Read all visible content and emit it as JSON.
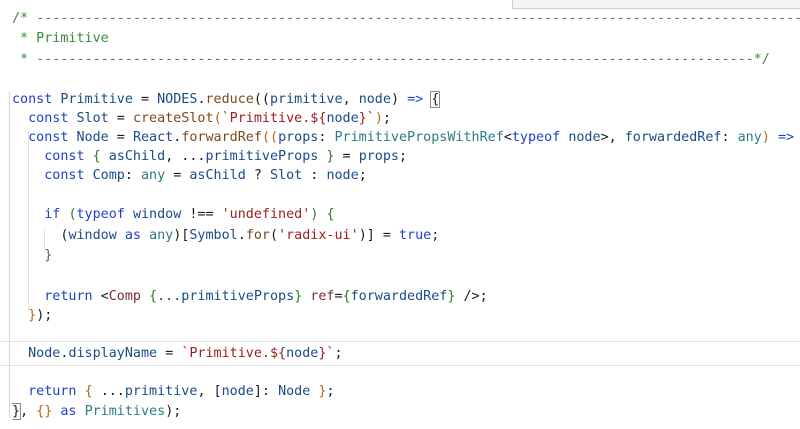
{
  "editor": {
    "lines": [
      {
        "tokens": [
          {
            "t": "/* ",
            "c": "cm"
          },
          {
            "t": "--------------------------------------------------------------------------------------------------",
            "c": "cm"
          }
        ]
      },
      {
        "tokens": [
          {
            "t": " * Primitive",
            "c": "cm"
          }
        ]
      },
      {
        "tokens": [
          {
            "t": " * -----------------------------------------------------------------------------------------*/",
            "c": "cm"
          }
        ]
      },
      {
        "tokens": []
      },
      {
        "tokens": [
          {
            "t": "const ",
            "c": "kw"
          },
          {
            "t": "Primitive",
            "c": "var"
          },
          {
            "t": " = ",
            "c": "p1"
          },
          {
            "t": "NODES",
            "c": "var"
          },
          {
            "t": ".",
            "c": "p1"
          },
          {
            "t": "reduce",
            "c": "fn"
          },
          {
            "t": "((",
            "c": "p1"
          },
          {
            "t": "primitive",
            "c": "var"
          },
          {
            "t": ", ",
            "c": "p1"
          },
          {
            "t": "node",
            "c": "var"
          },
          {
            "t": ") ",
            "c": "p1"
          },
          {
            "t": "=>",
            "c": "kw"
          },
          {
            "t": " ",
            "c": "p1"
          },
          {
            "t": "{",
            "c": "p1",
            "match": true
          }
        ]
      },
      {
        "tokens": [
          {
            "t": "  const ",
            "c": "kw"
          },
          {
            "t": "Slot",
            "c": "var"
          },
          {
            "t": " = ",
            "c": "p1"
          },
          {
            "t": "createSlot",
            "c": "fn"
          },
          {
            "t": "(",
            "c": "p2"
          },
          {
            "t": "`Primitive.${",
            "c": "str"
          },
          {
            "t": "node",
            "c": "var"
          },
          {
            "t": "}`",
            "c": "str"
          },
          {
            "t": ")",
            "c": "p2"
          },
          {
            "t": ";",
            "c": "p1"
          }
        ]
      },
      {
        "tokens": [
          {
            "t": "  const ",
            "c": "kw"
          },
          {
            "t": "Node",
            "c": "var"
          },
          {
            "t": " = ",
            "c": "p1"
          },
          {
            "t": "React",
            "c": "var"
          },
          {
            "t": ".",
            "c": "p1"
          },
          {
            "t": "forwardRef",
            "c": "fn"
          },
          {
            "t": "((",
            "c": "p2"
          },
          {
            "t": "props",
            "c": "var"
          },
          {
            "t": ": ",
            "c": "p1"
          },
          {
            "t": "PrimitivePropsWithRef",
            "c": "ty"
          },
          {
            "t": "<",
            "c": "p1"
          },
          {
            "t": "typeof ",
            "c": "kw"
          },
          {
            "t": "node",
            "c": "var"
          },
          {
            "t": ">, ",
            "c": "p1"
          },
          {
            "t": "forwardedRef",
            "c": "var"
          },
          {
            "t": ": ",
            "c": "p1"
          },
          {
            "t": "any",
            "c": "ty"
          },
          {
            "t": ") ",
            "c": "p2"
          },
          {
            "t": "=>",
            "c": "kw"
          },
          {
            "t": " {",
            "c": "p2"
          }
        ]
      },
      {
        "tokens": [
          {
            "t": "    const ",
            "c": "kw"
          },
          {
            "t": "{ ",
            "c": "p3"
          },
          {
            "t": "asChild",
            "c": "var"
          },
          {
            "t": ", ...",
            "c": "p1"
          },
          {
            "t": "primitiveProps",
            "c": "var"
          },
          {
            "t": " }",
            "c": "p3"
          },
          {
            "t": " = ",
            "c": "p1"
          },
          {
            "t": "props",
            "c": "var"
          },
          {
            "t": ";",
            "c": "p1"
          }
        ]
      },
      {
        "tokens": [
          {
            "t": "    const ",
            "c": "kw"
          },
          {
            "t": "Comp",
            "c": "var"
          },
          {
            "t": ": ",
            "c": "p1"
          },
          {
            "t": "any",
            "c": "ty"
          },
          {
            "t": " = ",
            "c": "p1"
          },
          {
            "t": "asChild",
            "c": "var"
          },
          {
            "t": " ? ",
            "c": "p1"
          },
          {
            "t": "Slot",
            "c": "var"
          },
          {
            "t": " : ",
            "c": "p1"
          },
          {
            "t": "node",
            "c": "var"
          },
          {
            "t": ";",
            "c": "p1"
          }
        ]
      },
      {
        "tokens": []
      },
      {
        "tokens": [
          {
            "t": "    if ",
            "c": "kw"
          },
          {
            "t": "(",
            "c": "p3"
          },
          {
            "t": "typeof ",
            "c": "kw"
          },
          {
            "t": "window",
            "c": "var"
          },
          {
            "t": " !== ",
            "c": "p1"
          },
          {
            "t": "'undefined'",
            "c": "str"
          },
          {
            "t": ") ",
            "c": "p3"
          },
          {
            "t": "{",
            "c": "p3"
          }
        ]
      },
      {
        "tokens": [
          {
            "t": "      (",
            "c": "p1"
          },
          {
            "t": "window",
            "c": "var"
          },
          {
            "t": " as ",
            "c": "kw"
          },
          {
            "t": "any",
            "c": "ty"
          },
          {
            "t": ")[",
            "c": "p1"
          },
          {
            "t": "Symbol",
            "c": "var"
          },
          {
            "t": ".",
            "c": "p1"
          },
          {
            "t": "for",
            "c": "fn"
          },
          {
            "t": "(",
            "c": "p1"
          },
          {
            "t": "'radix-ui'",
            "c": "str"
          },
          {
            "t": ")] = ",
            "c": "p1"
          },
          {
            "t": "true",
            "c": "kw"
          },
          {
            "t": ";",
            "c": "p1"
          }
        ]
      },
      {
        "tokens": [
          {
            "t": "    }",
            "c": "p3"
          }
        ]
      },
      {
        "tokens": []
      },
      {
        "tokens": [
          {
            "t": "    return ",
            "c": "kw"
          },
          {
            "t": "<",
            "c": "p1"
          },
          {
            "t": "Comp",
            "c": "tag"
          },
          {
            "t": " {",
            "c": "p3"
          },
          {
            "t": "...primitiveProps",
            "c": "var"
          },
          {
            "t": "} ",
            "c": "p3"
          },
          {
            "t": "ref",
            "c": "tag"
          },
          {
            "t": "=",
            "c": "p1"
          },
          {
            "t": "{",
            "c": "p3"
          },
          {
            "t": "forwardedRef",
            "c": "var"
          },
          {
            "t": "}",
            "c": "p3"
          },
          {
            "t": " />",
            "c": "p1"
          },
          {
            "t": ";",
            "c": "p1"
          }
        ]
      },
      {
        "tokens": [
          {
            "t": "  }",
            "c": "p2"
          },
          {
            "t": ");",
            "c": "p1"
          }
        ]
      },
      {
        "tokens": []
      },
      {
        "tokens": [
          {
            "t": "  ",
            "c": "p1"
          },
          {
            "t": "Node",
            "c": "var"
          },
          {
            "t": ".",
            "c": "p1"
          },
          {
            "t": "displayName",
            "c": "var"
          },
          {
            "t": " = ",
            "c": "p1"
          },
          {
            "t": "`Primitive.${",
            "c": "str"
          },
          {
            "t": "node",
            "c": "var"
          },
          {
            "t": "}`",
            "c": "str"
          },
          {
            "t": ";",
            "c": "p1"
          }
        ]
      },
      {
        "tokens": []
      },
      {
        "tokens": [
          {
            "t": "  return ",
            "c": "kw"
          },
          {
            "t": "{ ",
            "c": "p2"
          },
          {
            "t": "...",
            "c": "p1"
          },
          {
            "t": "primitive",
            "c": "var"
          },
          {
            "t": ", [",
            "c": "p1"
          },
          {
            "t": "node",
            "c": "var"
          },
          {
            "t": "]: ",
            "c": "p1"
          },
          {
            "t": "Node",
            "c": "var"
          },
          {
            "t": " }",
            "c": "p2"
          },
          {
            "t": ";",
            "c": "p1"
          }
        ]
      },
      {
        "tokens": [
          {
            "t": "}",
            "c": "p1",
            "match": true
          },
          {
            "t": ", ",
            "c": "p1"
          },
          {
            "t": "{}",
            "c": "p2"
          },
          {
            "t": " as ",
            "c": "kw"
          },
          {
            "t": "Primitives",
            "c": "ty"
          },
          {
            "t": ");",
            "c": "p1"
          }
        ]
      }
    ]
  }
}
